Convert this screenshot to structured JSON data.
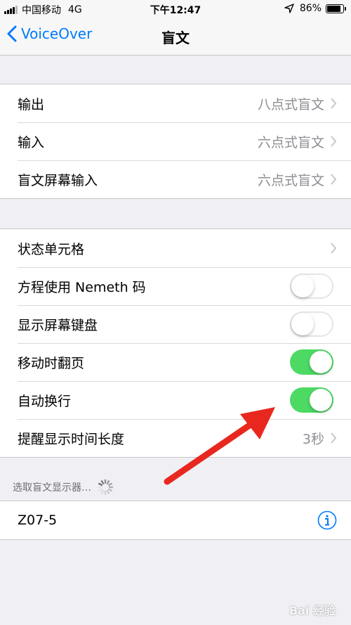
{
  "status_bar": {
    "carrier": "中国移动",
    "network": "4G",
    "time": "下午12:47",
    "battery_percent": "86%",
    "battery_level": 0.86
  },
  "nav": {
    "back_label": "VoiceOver",
    "title": "盲文"
  },
  "group1": {
    "rows": [
      {
        "label": "输出",
        "value": "八点式盲文"
      },
      {
        "label": "输入",
        "value": "六点式盲文"
      },
      {
        "label": "盲文屏幕输入",
        "value": "六点式盲文"
      }
    ]
  },
  "group2": {
    "rows": [
      {
        "label": "状态单元格"
      },
      {
        "label": "方程使用 Nemeth 码",
        "toggle": false
      },
      {
        "label": "显示屏幕键盘",
        "toggle": false
      },
      {
        "label": "移动时翻页",
        "toggle": true
      },
      {
        "label": "自动换行",
        "toggle": true
      },
      {
        "label": "提醒显示时间长度",
        "value": "3秒"
      }
    ]
  },
  "display_section": {
    "header": "选取盲文显示器…",
    "device": "Z07-5"
  },
  "colors": {
    "accent": "#007aff",
    "toggle_on": "#4cd964",
    "annotation_arrow": "#e8281f"
  },
  "watermark": "Bai 经验"
}
